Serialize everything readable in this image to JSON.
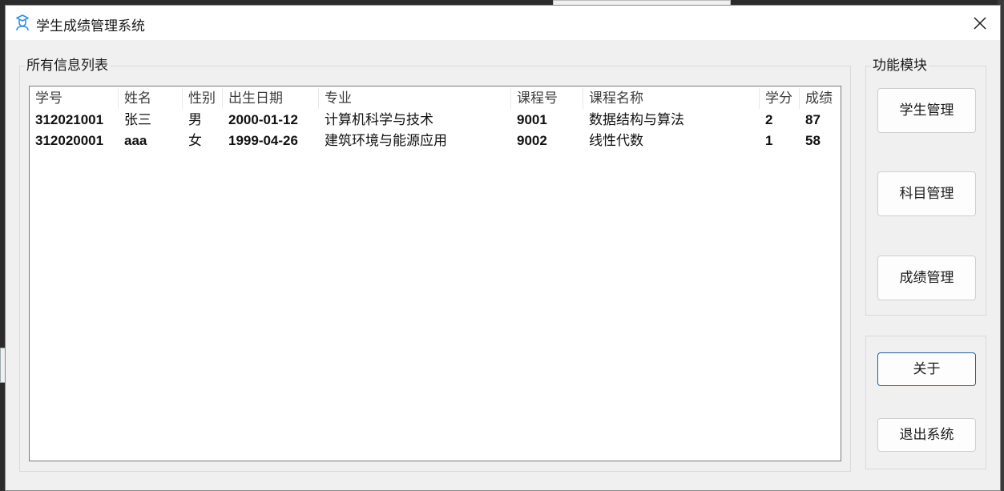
{
  "window": {
    "title": "学生成绩管理系统"
  },
  "background": {
    "fragment_text": "学生管理"
  },
  "info_group": {
    "label": "所有信息列表",
    "columns": [
      "学号",
      "姓名",
      "性别",
      "出生日期",
      "专业",
      "课程号",
      "课程名称",
      "学分",
      "成绩"
    ],
    "rows": [
      [
        "312021001",
        "张三",
        "男",
        "2000-01-12",
        "计算机科学与技术",
        "9001",
        "数据结构与算法",
        "2",
        "87"
      ],
      [
        "312020001",
        "aaa",
        "女",
        "1999-04-26",
        "建筑环境与能源应用",
        "9002",
        "线性代数",
        "1",
        "58"
      ]
    ]
  },
  "func_group": {
    "label": "功能模块",
    "buttons": [
      "学生管理",
      "科目管理",
      "成绩管理"
    ]
  },
  "sys_group": {
    "about_label": "关于",
    "exit_label": "退出系统"
  },
  "colors": {
    "icon_accent": "#2f8fe6",
    "focus_border": "#1f5d9a"
  }
}
